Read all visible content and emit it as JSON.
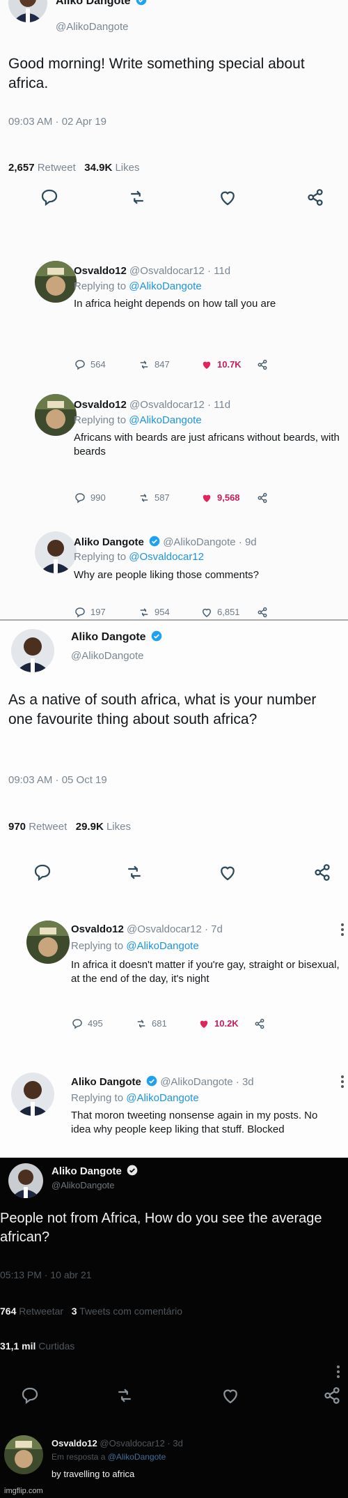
{
  "panel1": {
    "tweet": {
      "author": "Aliko Dangote",
      "handle": "@AlikoDangote",
      "text": "Good morning! Write something special about africa.",
      "timestamp": "09:03 AM · 02 Apr 19",
      "retweet_count": "2,657",
      "retweet_label": "Retweet",
      "likes_count": "34.9K",
      "likes_label": "Likes"
    },
    "replies": [
      {
        "author": "Osvaldo12",
        "handle_time": "@Osvaldocar12 · 11d",
        "replying_prefix": "Replying to",
        "replying_to": "@AlikoDangote",
        "text": "In africa height depends on how tall you are",
        "replies": "564",
        "retweets": "847",
        "likes": "10.7K"
      },
      {
        "author": "Osvaldo12",
        "handle_time": "@Osvaldocar12 · 11d",
        "replying_prefix": "Replying to",
        "replying_to": "@AlikoDangote",
        "text": "Africans with beards are just africans without beards, with beards",
        "replies": "990",
        "retweets": "587",
        "likes": "9,568"
      },
      {
        "author": "Aliko Dangote",
        "handle_time": "@AlikoDangote · 9d",
        "replying_prefix": "Replying to",
        "replying_to": "@Osvaldocar12",
        "text": "Why are people liking those comments?",
        "replies": "197",
        "retweets": "954",
        "likes": "6,851"
      }
    ]
  },
  "panel2": {
    "tweet": {
      "author": "Aliko Dangote",
      "handle": "@AlikoDangote",
      "text": "As a native of south africa, what is your number one favourite thing about south africa?",
      "timestamp": "09:03 AM · 05 Oct 19",
      "retweet_count": "970",
      "retweet_label": "Retweet",
      "likes_count": "29.9K",
      "likes_label": "Likes"
    },
    "replies": [
      {
        "author": "Osvaldo12",
        "handle_time": "@Osvaldocar12 · 7d",
        "replying_prefix": "Replying to",
        "replying_to": "@AlikoDangote",
        "text": "In africa it doesn't matter if you're gay, straight or bisexual, at the end of the day, it's night",
        "replies": "495",
        "retweets": "681",
        "likes": "10.2K"
      },
      {
        "author": "Aliko Dangote",
        "handle_time": "@AlikoDangote · 3d",
        "replying_prefix": "Replying to",
        "replying_to": "@AlikoDangote",
        "text": "That moron tweeting nonsense again in my posts. No idea why people keep liking that stuff. Blocked"
      }
    ]
  },
  "panel3": {
    "tweet": {
      "author": "Aliko Dangote",
      "handle": "@AlikoDangote",
      "text": "People not from Africa, How do you see the average african?",
      "timestamp": "05:13 PM · 10 abr 21",
      "retweet_count": "764",
      "retweet_label": "Retweetar",
      "comments_count": "3",
      "comments_label": "Tweets com comentário",
      "likes_count": "31,1 mil",
      "likes_label": "Curtidas"
    },
    "replies": [
      {
        "author": "Osvaldo12",
        "handle_time": "@Osvaldocar12 · 3d",
        "replying_prefix": "Em resposta a",
        "replying_to": "@AlikoDangote",
        "text": "by travelling to africa"
      }
    ]
  },
  "watermark": "imgflip.com",
  "colors": {
    "link_blue": "#1b95e0",
    "verified_blue": "#1da1f2",
    "like_red": "#e0245e",
    "muted_gray": "#7a8793"
  },
  "icons": [
    "reply-icon",
    "retweet-icon",
    "like-icon",
    "share-icon",
    "verified-badge-icon",
    "more-options-icon"
  ]
}
